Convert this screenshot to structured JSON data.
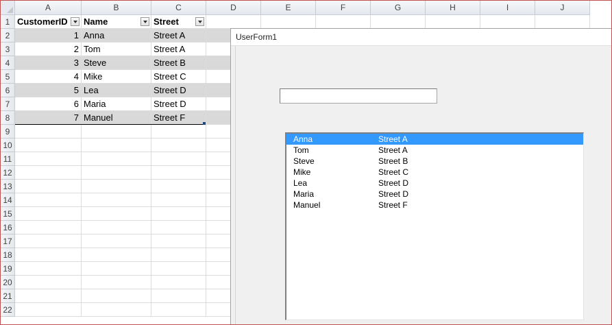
{
  "columns": [
    "A",
    "B",
    "C",
    "D",
    "E",
    "F",
    "G",
    "H",
    "I",
    "J"
  ],
  "rows": [
    "1",
    "2",
    "3",
    "4",
    "5",
    "6",
    "7",
    "8",
    "9",
    "10",
    "11",
    "12",
    "13",
    "14",
    "15",
    "16",
    "17",
    "18",
    "19",
    "20",
    "21",
    "22"
  ],
  "table": {
    "headers": [
      "CustomerID",
      "Name",
      "Street"
    ],
    "records": [
      {
        "id": "1",
        "name": "Anna",
        "street": "Street A"
      },
      {
        "id": "2",
        "name": "Tom",
        "street": "Street A"
      },
      {
        "id": "3",
        "name": "Steve",
        "street": "Street B"
      },
      {
        "id": "4",
        "name": "Mike",
        "street": "Street C"
      },
      {
        "id": "5",
        "name": "Lea",
        "street": "Street D"
      },
      {
        "id": "6",
        "name": "Maria",
        "street": "Street D"
      },
      {
        "id": "7",
        "name": "Manuel",
        "street": "Street F"
      }
    ]
  },
  "userform": {
    "title": "UserForm1",
    "textbox_value": "",
    "listbox": {
      "selected_index": 0,
      "items": [
        {
          "name": "Anna",
          "street": "Street A"
        },
        {
          "name": "Tom",
          "street": "Street A"
        },
        {
          "name": "Steve",
          "street": "Street B"
        },
        {
          "name": "Mike",
          "street": "Street C"
        },
        {
          "name": "Lea",
          "street": "Street D"
        },
        {
          "name": "Maria",
          "street": "Street D"
        },
        {
          "name": "Manuel",
          "street": "Street F"
        }
      ]
    }
  },
  "colors": {
    "selection": "#3399ff",
    "band": "#d9d9d9",
    "window_border": "#c0504d"
  }
}
